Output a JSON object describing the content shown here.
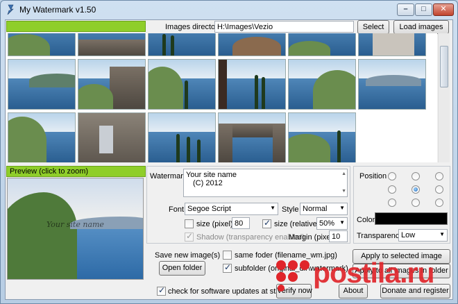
{
  "window": {
    "title": "My Watermark v1.50",
    "controls": {
      "minimize": "–",
      "maximize": "□",
      "close": "✕"
    }
  },
  "top": {
    "images_directory_label": "Images directory",
    "images_directory_value": "H:\\Images\\Vezio",
    "select_label": "Select",
    "load_images_label": "Load images"
  },
  "preview": {
    "label": "Preview (click to zoom)",
    "watermark_overlay": "Your site name"
  },
  "watermark": {
    "label": "Watermark",
    "text_line1": "Your site name",
    "text_line2": "(C) 2012",
    "font_label": "Font",
    "font_value": "Segoe Script",
    "style_label": "Style",
    "style_value": "Normal",
    "size_pixel_label": "size (pixel)",
    "size_pixel_value": "80",
    "size_pixel_checked": false,
    "size_relative_label": "size (relative)",
    "size_relative_checked": true,
    "size_relative_value": "50%",
    "shadow_label": "Shadow (transparency enabled)",
    "shadow_checked": true,
    "margin_label": "Margin (pixel)",
    "margin_value": "10"
  },
  "position": {
    "label": "Position",
    "selected_index": 4,
    "color_label": "Color",
    "color_value": "#000000",
    "transparency_label": "Transparency",
    "transparency_value": "Low"
  },
  "save": {
    "label": "Save new image(s) in:",
    "open_folder_label": "Open folder",
    "same_folder_label": "same foder (filename_wm.jpg)",
    "same_folder_checked": false,
    "subfolder_label": "subfolder (original_dir\\watermark)",
    "subfolder_checked": true,
    "apply_selected_label": "Apply to selected image",
    "apply_all_label": "Apply to all images in folder"
  },
  "footer": {
    "check_updates_label": "check for software updates at startup",
    "check_updates_checked": true,
    "verify_now_label": "Verify now",
    "about_label": "About",
    "donate_label": "Donate and register"
  },
  "overlay_watermark": "postila.ru",
  "colors": {
    "accent_green": "#8fce2a",
    "watermark_red": "#e0252a"
  }
}
